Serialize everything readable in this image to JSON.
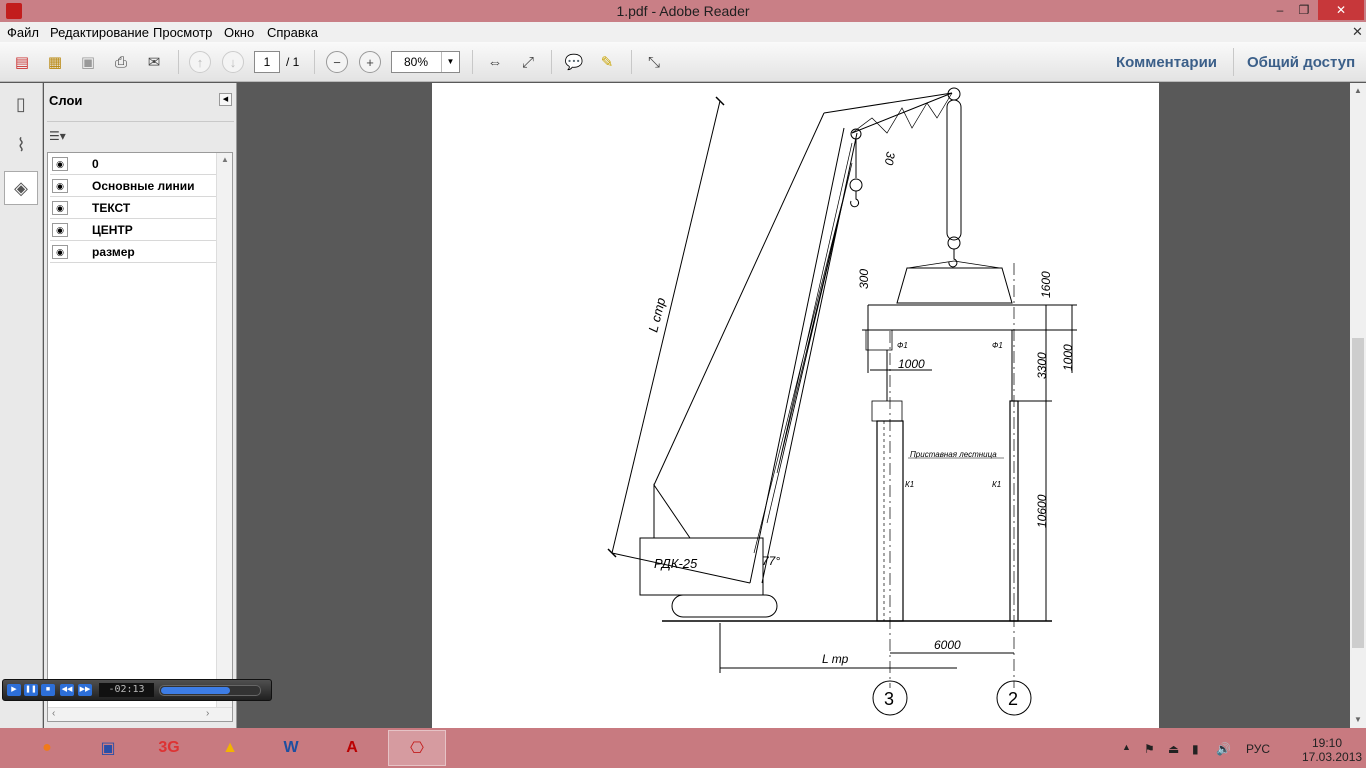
{
  "window": {
    "title": "1.pdf - Adobe Reader",
    "minimize": "‒",
    "maximize": "❐",
    "close": "✕"
  },
  "menu": {
    "items": [
      "Файл",
      "Редактирование",
      "Просмотр",
      "Окно",
      "Справка"
    ],
    "close": "✕"
  },
  "toolbar": {
    "page_current": "1",
    "page_total": "/ 1",
    "zoom": "80%",
    "comments": "Комментарии",
    "share": "Общий доступ"
  },
  "layers_panel": {
    "title": "Слои",
    "layers": [
      {
        "name": "0"
      },
      {
        "name": "Основные линии"
      },
      {
        "name": "ТЕКСТ"
      },
      {
        "name": "ЦЕНТР"
      },
      {
        "name": "размер"
      }
    ]
  },
  "media_player": {
    "time": "-02:13",
    "progress": 0.7
  },
  "drawing": {
    "boom_length_label": "L стр",
    "crane_label": "РДК-25",
    "angle_boom": "77°",
    "angle_jib": "30",
    "dim_top": "300",
    "dim_1600": "1600",
    "dim_1000_right": "1000",
    "dim_3300": "3300",
    "dim_1000_left": "1000",
    "dim_10600": "10600",
    "dim_6000": "6000",
    "reach_label": "L тр",
    "ladder_label": "Приставная лестница",
    "mark_f1_left": "Ф1",
    "mark_f1_right": "Ф1",
    "mark_k1_left": "К1",
    "mark_k1_right": "К1",
    "axis_3": "3",
    "axis_2": "2"
  },
  "tray": {
    "lang": "РУС",
    "time": "19:10",
    "date": "17.03.2013"
  }
}
